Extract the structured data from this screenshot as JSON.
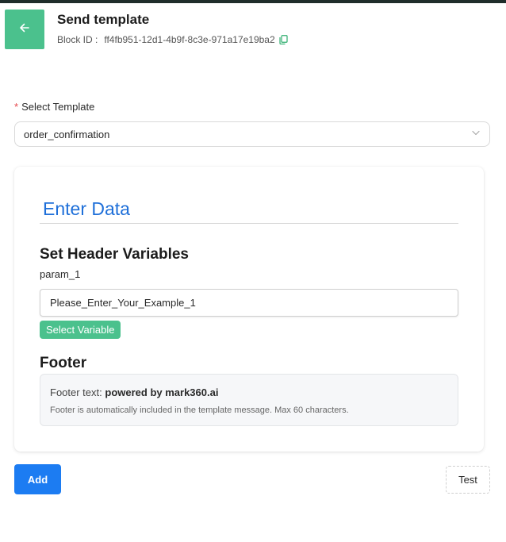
{
  "header": {
    "title": "Send template",
    "block_id_label": "Block ID :",
    "block_id_value": "ff4fb951-12d1-4b9f-8c3e-971a17e19ba2",
    "back_icon": "arrow-left-icon",
    "copy_icon": "copy-icon"
  },
  "template_select": {
    "required_mark": "*",
    "label": "Select Template",
    "value": "order_confirmation",
    "dropdown_icon": "chevron-down-icon"
  },
  "card": {
    "heading": "Enter Data",
    "header_vars_title": "Set Header Variables",
    "param_label": "param_1",
    "param_value": "Please_Enter_Your_Example_1",
    "select_variable_label": "Select Variable",
    "footer_title": "Footer",
    "footer_text_prefix": "Footer text:",
    "footer_text_value": "powered by mark360.ai",
    "footer_note": "Footer is automatically included in the template message. Max 60 characters."
  },
  "actions": {
    "add_label": "Add",
    "test_label": "Test"
  },
  "colors": {
    "accent_green": "#4bc18d",
    "primary_blue": "#1c7cf2",
    "heading_blue": "#1e6fd9",
    "required_red": "#e5484d"
  }
}
